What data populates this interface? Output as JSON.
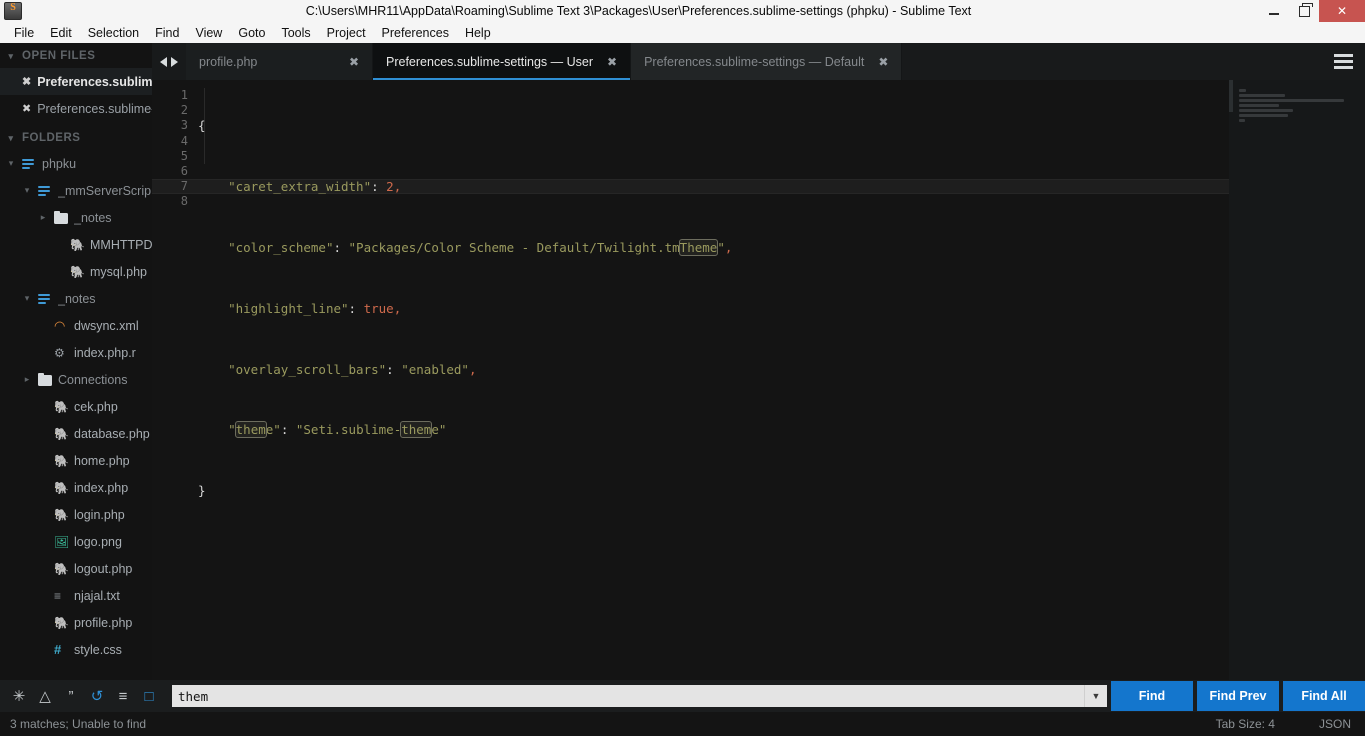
{
  "window": {
    "title": "C:\\Users\\MHR11\\AppData\\Roaming\\Sublime Text 3\\Packages\\User\\Preferences.sublime-settings (phpku) - Sublime Text",
    "app_icon": "sublime-logo-icon",
    "minimize_label": "minimize-icon",
    "maximize_label": "restore-icon",
    "close_label": "✕"
  },
  "menubar": {
    "items": [
      {
        "label": "File"
      },
      {
        "label": "Edit"
      },
      {
        "label": "Selection"
      },
      {
        "label": "Find"
      },
      {
        "label": "View"
      },
      {
        "label": "Goto"
      },
      {
        "label": "Tools"
      },
      {
        "label": "Project"
      },
      {
        "label": "Preferences"
      },
      {
        "label": "Help"
      }
    ]
  },
  "sidebar": {
    "open_files_header": "OPEN FILES",
    "folders_header": "FOLDERS",
    "open_files": [
      {
        "label": "Preferences.sublime-s",
        "close": "✖",
        "active": true
      },
      {
        "label": "Preferences.sublime-s",
        "close": "✖",
        "active": false
      }
    ],
    "tree": [
      {
        "label": "phpku",
        "icon": "project-icon",
        "arrow": "⌄",
        "indent": 1,
        "kind": "folder"
      },
      {
        "label": "_mmServerScrip",
        "icon": "project-icon",
        "arrow": "⌄",
        "indent": 2,
        "kind": "folder"
      },
      {
        "label": "_notes",
        "icon": "folder-icon",
        "arrow": "›",
        "indent": 3,
        "kind": "folder"
      },
      {
        "label": "MMHTTPDB",
        "icon": "php-icon",
        "arrow": "",
        "indent": 4,
        "kind": "file"
      },
      {
        "label": "mysql.php",
        "icon": "php-icon",
        "arrow": "",
        "indent": 4,
        "kind": "file"
      },
      {
        "label": "_notes",
        "icon": "project-icon",
        "arrow": "⌄",
        "indent": 2,
        "kind": "folder"
      },
      {
        "label": "dwsync.xml",
        "icon": "rss-icon",
        "arrow": "",
        "indent": 3,
        "kind": "file"
      },
      {
        "label": "index.php.r",
        "icon": "gear-icon",
        "arrow": "",
        "indent": 3,
        "kind": "file"
      },
      {
        "label": "Connections",
        "icon": "folder-icon",
        "arrow": "›",
        "indent": 2,
        "kind": "folder"
      },
      {
        "label": "cek.php",
        "icon": "php-icon",
        "arrow": "",
        "indent": 3,
        "kind": "file"
      },
      {
        "label": "database.php",
        "icon": "php-icon",
        "arrow": "",
        "indent": 3,
        "kind": "file"
      },
      {
        "label": "home.php",
        "icon": "php-icon",
        "arrow": "",
        "indent": 3,
        "kind": "file"
      },
      {
        "label": "index.php",
        "icon": "php-icon",
        "arrow": "",
        "indent": 3,
        "kind": "file"
      },
      {
        "label": "login.php",
        "icon": "php-icon",
        "arrow": "",
        "indent": 3,
        "kind": "file"
      },
      {
        "label": "logo.png",
        "icon": "image-icon",
        "arrow": "",
        "indent": 3,
        "kind": "file"
      },
      {
        "label": "logout.php",
        "icon": "php-icon",
        "arrow": "",
        "indent": 3,
        "kind": "file"
      },
      {
        "label": "njajal.txt",
        "icon": "text-icon",
        "arrow": "",
        "indent": 3,
        "kind": "file"
      },
      {
        "label": "profile.php",
        "icon": "php-icon",
        "arrow": "",
        "indent": 3,
        "kind": "file"
      },
      {
        "label": "style.css",
        "icon": "css-icon",
        "arrow": "",
        "indent": 3,
        "kind": "file"
      }
    ]
  },
  "tabs": {
    "prev_icon": "arrow-left-icon",
    "next_icon": "arrow-right-icon",
    "menu_icon": "hamburger-menu-icon",
    "items": [
      {
        "label": "profile.php",
        "close": "✖",
        "active": false
      },
      {
        "label": "Preferences.sublime-settings — User",
        "close": "✖",
        "active": true
      },
      {
        "label": "Preferences.sublime-settings — Default",
        "close": "✖",
        "active": false
      }
    ]
  },
  "editor": {
    "line_numbers": [
      "1",
      "2",
      "3",
      "4",
      "5",
      "6",
      "7",
      "8"
    ],
    "highlight_line": 7,
    "lines": [
      {
        "n": 1,
        "text": "{"
      },
      {
        "n": 2,
        "text": "    \"caret_extra_width\": 2,"
      },
      {
        "n": 3,
        "text": "    \"color_scheme\": \"Packages/Color Scheme - Default/Twilight.tmTheme\","
      },
      {
        "n": 4,
        "text": "    \"highlight_line\": true,"
      },
      {
        "n": 5,
        "text": "    \"overlay_scroll_bars\": \"enabled\","
      },
      {
        "n": 6,
        "text": "    \"theme\": \"Seti.sublime-theme\""
      },
      {
        "n": 7,
        "text": "}"
      },
      {
        "n": 8,
        "text": ""
      }
    ],
    "tokens": {
      "l1_brace": "{",
      "l2_key": "\"caret_extra_width\"",
      "l2_colon": ": ",
      "l2_val": "2",
      "l2_comma": ",",
      "l3_key": "\"color_scheme\"",
      "l3_colon": ": ",
      "l3_str_a": "\"Packages/Color Scheme - Default/Twilight.tm",
      "l3_match": "Theme",
      "l3_str_b": "\"",
      "l3_comma": ",",
      "l4_key": "\"highlight_line\"",
      "l4_colon": ": ",
      "l4_val": "true",
      "l4_comma": ",",
      "l5_key": "\"overlay_scroll_bars\"",
      "l5_colon": ": ",
      "l5_val": "\"enabled\"",
      "l5_comma": ",",
      "l6_q1": "\"",
      "l6_match1": "them",
      "l6_key_rest": "e\"",
      "l6_colon": ": ",
      "l6_str_a": "\"Seti.sublime-",
      "l6_match2": "them",
      "l6_str_b": "e\"",
      "l7_brace": "}"
    }
  },
  "find": {
    "options": [
      {
        "name": "regex-icon",
        "glyph": "✳",
        "on": false
      },
      {
        "name": "case-sensitive-icon",
        "glyph": "△",
        "on": false
      },
      {
        "name": "whole-word-icon",
        "glyph": "”",
        "on": false
      },
      {
        "name": "wrap-icon",
        "glyph": "↺",
        "on": true
      },
      {
        "name": "in-selection-icon",
        "glyph": "≡",
        "on": false
      },
      {
        "name": "highlight-results-icon",
        "glyph": "□",
        "on": true
      }
    ],
    "query": "them",
    "placeholder": "Find",
    "dropdown_icon": "chevron-down-icon",
    "buttons": [
      {
        "label": "Find"
      },
      {
        "label": "Find Prev"
      },
      {
        "label": "Find All"
      }
    ],
    "accent_color": "#1476cd"
  },
  "status": {
    "message": "3 matches; Unable to find",
    "tab_size": "Tab Size: 4",
    "syntax": "JSON"
  }
}
